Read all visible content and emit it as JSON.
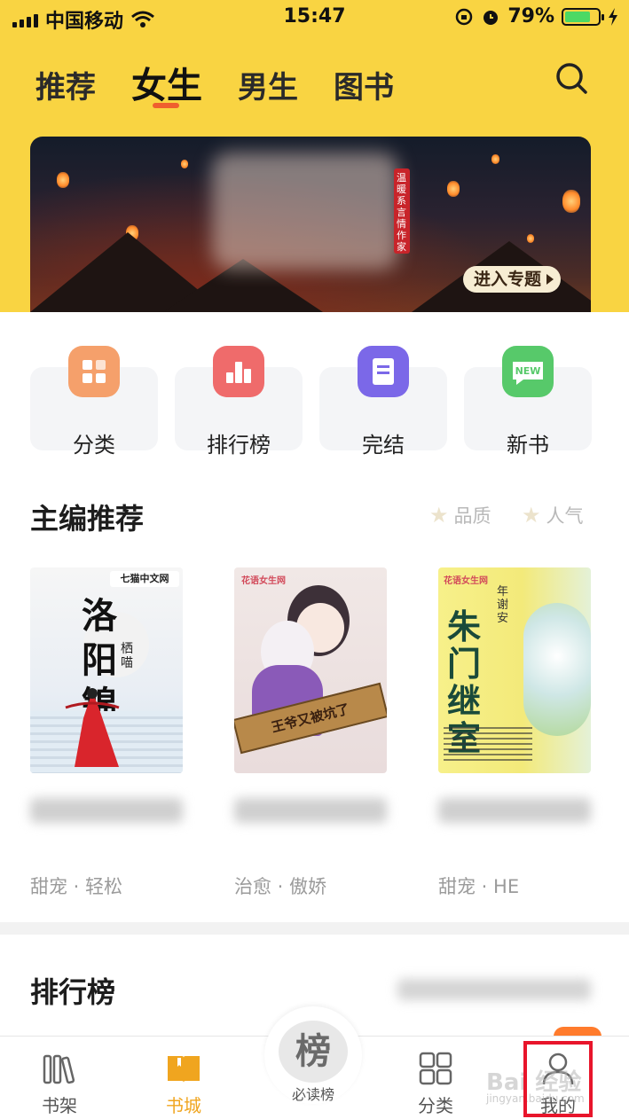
{
  "status_bar": {
    "carrier": "中国移动",
    "time": "15:47",
    "battery": "79%",
    "battery_level": 0.79
  },
  "top_tabs": [
    {
      "label": "推荐",
      "active": false
    },
    {
      "label": "女生",
      "active": true
    },
    {
      "label": "男生",
      "active": false
    },
    {
      "label": "图书",
      "active": false
    }
  ],
  "banner": {
    "side_text": "温暖系言情作家",
    "button": "进入专题"
  },
  "categories": [
    {
      "label": "分类",
      "color": "#f5a06b"
    },
    {
      "label": "排行榜",
      "color": "#ef6b6b"
    },
    {
      "label": "完结",
      "color": "#7b68e8"
    },
    {
      "label": "新书",
      "color": "#57c96a"
    }
  ],
  "editor_picks": {
    "title": "主编推荐",
    "filters": [
      "品质",
      "人气"
    ],
    "books": [
      {
        "publisher": "七猫中文网",
        "cover_title": "洛阳锦",
        "author": "栖喵",
        "tags": "甜宠 · 轻松"
      },
      {
        "publisher": "花语女生网",
        "cover_title": "王爷又被坑了",
        "tags": "治愈 · 傲娇"
      },
      {
        "publisher": "花语女生网",
        "cover_title": "朱门继室",
        "author": "年谢安",
        "tags": "甜宠 · HE"
      }
    ]
  },
  "ranking": {
    "title": "排行榜"
  },
  "bottom_nav": [
    {
      "label": "书架",
      "icon": "bookshelf-icon",
      "active": false
    },
    {
      "label": "书城",
      "icon": "book-open-icon",
      "active": true
    },
    {
      "label": "分类",
      "icon": "grid-icon",
      "active": false
    },
    {
      "label": "我的",
      "icon": "user-icon",
      "active": false
    }
  ],
  "center_nav": {
    "badge": "榜",
    "label": "必读榜"
  },
  "colors": {
    "header_yellow": "#f9d442",
    "active_orange": "#f0a51f",
    "underline": "#ef5f2e",
    "highlight_red": "#e8152b"
  },
  "watermark": {
    "text": "Bai 经验",
    "sub": "jingyan.baidu.com"
  }
}
